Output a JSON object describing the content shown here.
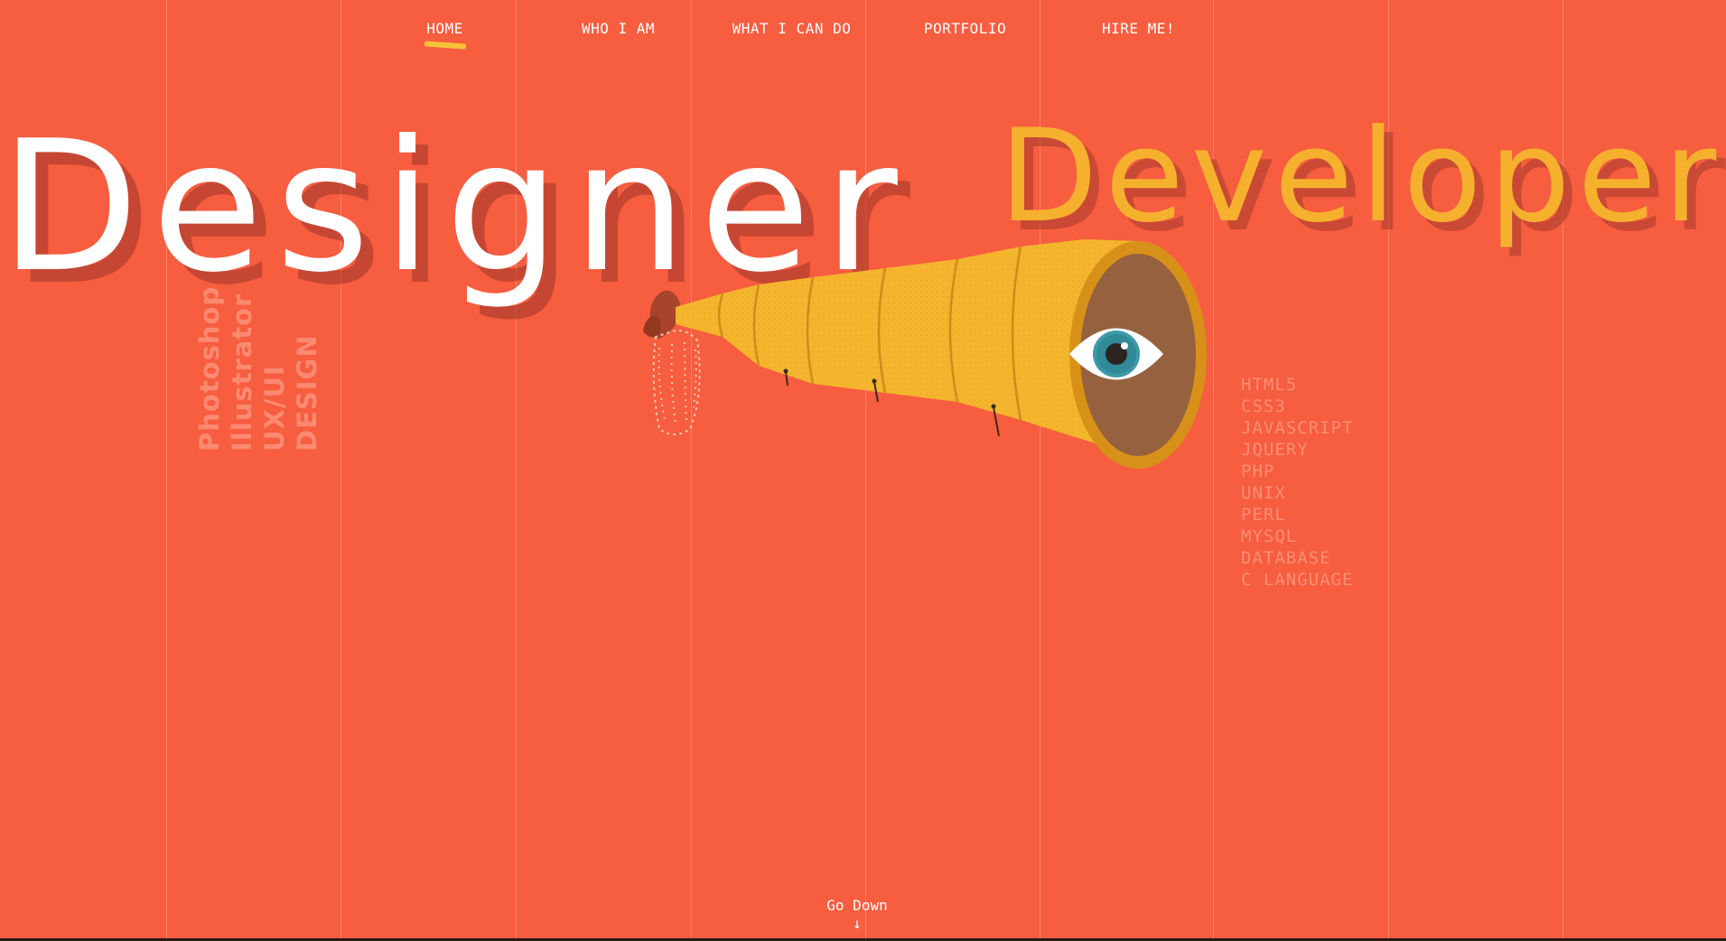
{
  "nav": {
    "items": [
      {
        "label": "HOME",
        "active": true
      },
      {
        "label": "WHO I AM",
        "active": false
      },
      {
        "label": "WHAT I CAN DO",
        "active": false
      },
      {
        "label": "PORTFOLIO",
        "active": false
      },
      {
        "label": "HIRE ME!",
        "active": false
      }
    ]
  },
  "hero": {
    "left_word": "Designer",
    "right_word": "Developer"
  },
  "design_skills": [
    "Photoshop",
    "Illustrator",
    "UX/UI",
    "DESIGN"
  ],
  "dev_skills": [
    "HTML5",
    "CSS3",
    "JAVASCRIPT",
    "JQUERY",
    "PHP",
    "UNIX",
    "PERL",
    "MYSQL",
    "DATABASE",
    "C LANGUAGE"
  ],
  "footer": {
    "go_down_label": "Go Down",
    "go_down_arrow": "↓"
  },
  "colors": {
    "background": "#f75d3f",
    "accent_yellow": "#f5b12e",
    "nav_underline": "#f7c23a",
    "text": "#ffffff"
  }
}
